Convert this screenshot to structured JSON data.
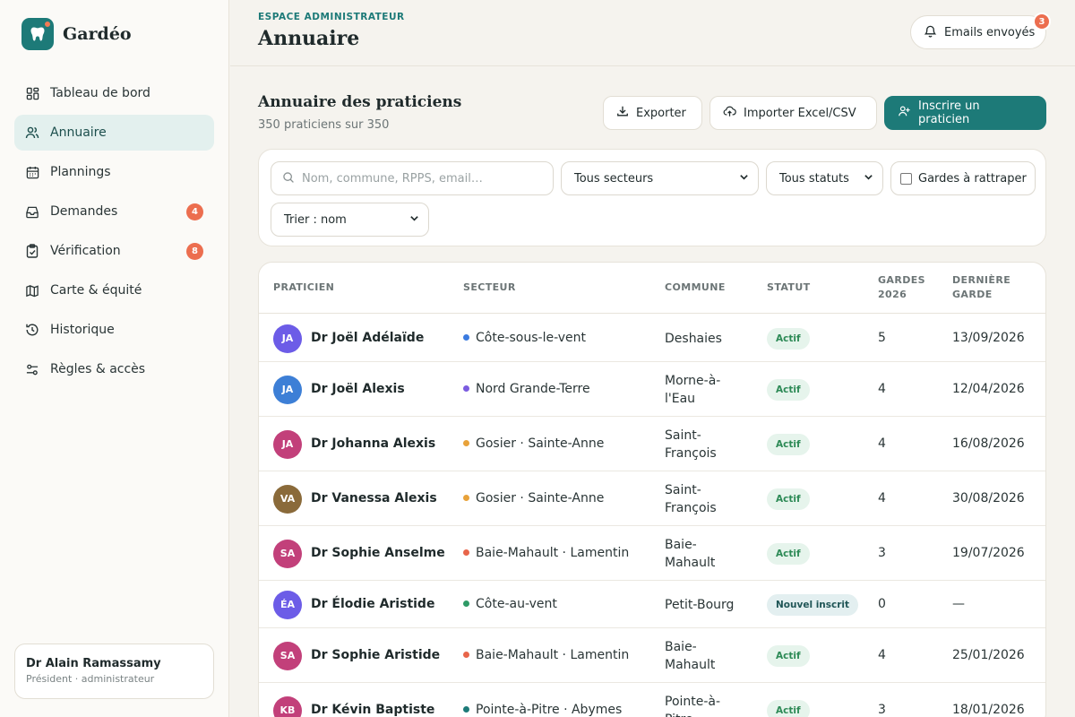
{
  "app": {
    "name": "Gardéo"
  },
  "colors": {
    "accent": "#1d7a78",
    "badge": "#ec6e4f",
    "active_bg": "#e3f0ee"
  },
  "sidebar": {
    "items": [
      {
        "label": "Tableau de bord",
        "icon": "dashboard-icon"
      },
      {
        "label": "Annuaire",
        "icon": "users-icon",
        "active": true
      },
      {
        "label": "Plannings",
        "icon": "calendar-icon"
      },
      {
        "label": "Demandes",
        "icon": "inbox-icon",
        "badge": "4"
      },
      {
        "label": "Vérification",
        "icon": "clipboard-check-icon",
        "badge": "8"
      },
      {
        "label": "Carte & équité",
        "icon": "map-icon"
      },
      {
        "label": "Historique",
        "icon": "history-icon"
      },
      {
        "label": "Règles & accès",
        "icon": "sliders-icon"
      }
    ],
    "user": {
      "name": "Dr Alain Ramassamy",
      "role": "Président · administrateur"
    }
  },
  "header": {
    "eyebrow": "ESPACE ADMINISTRATEUR",
    "title": "Annuaire",
    "emails_label": "Emails envoyés",
    "emails_badge": "3"
  },
  "section": {
    "title": "Annuaire des praticiens",
    "subtitle": "350 praticiens sur 350",
    "export_label": "Exporter",
    "import_label": "Importer Excel/CSV",
    "register_label": "Inscrire un praticien"
  },
  "filters": {
    "search_placeholder": "Nom, commune, RPPS, email…",
    "sector_selected": "Tous secteurs",
    "status_selected": "Tous statuts",
    "checkbox_label": "Gardes à rattraper",
    "sort_selected": "Trier : nom"
  },
  "table": {
    "headers": {
      "praticien": "PRATICIEN",
      "secteur": "SECTEUR",
      "commune": "COMMUNE",
      "statut": "STATUT",
      "gardes_1": "GARDES",
      "gardes_2": "2026",
      "derniere_1": "DERNIÈRE",
      "derniere_2": "GARDE"
    },
    "rows": [
      {
        "initials": "JA",
        "avatar_color": "#6c5ce7",
        "name": "Dr Joël Adélaïde",
        "sector": "Côte-sous-le-vent",
        "sector_color": "#3b7be0",
        "commune_1": "Deshaies",
        "commune_2": "",
        "status": "Actif",
        "gardes": "5",
        "last": "13/09/2026"
      },
      {
        "initials": "JA",
        "avatar_color": "#3d7fd6",
        "name": "Dr Joël Alexis",
        "sector": "Nord Grande-Terre",
        "sector_color": "#7b5ce0",
        "commune_1": "Morne-à-",
        "commune_2": "l'Eau",
        "status": "Actif",
        "gardes": "4",
        "last": "12/04/2026"
      },
      {
        "initials": "JA",
        "avatar_color": "#c2407a",
        "name": "Dr Johanna Alexis",
        "sector": "Gosier · Sainte-Anne",
        "sector_color": "#e8a23a",
        "commune_1": "Saint-",
        "commune_2": "François",
        "status": "Actif",
        "gardes": "4",
        "last": "16/08/2026"
      },
      {
        "initials": "VA",
        "avatar_color": "#8a6a3a",
        "name": "Dr Vanessa Alexis",
        "sector": "Gosier · Sainte-Anne",
        "sector_color": "#e8a23a",
        "commune_1": "Saint-",
        "commune_2": "François",
        "status": "Actif",
        "gardes": "4",
        "last": "30/08/2026"
      },
      {
        "initials": "SA",
        "avatar_color": "#c2407a",
        "name": "Dr Sophie Anselme",
        "sector": "Baie-Mahault · Lamentin",
        "sector_color": "#e8654a",
        "commune_1": "Baie-",
        "commune_2": "Mahault",
        "status": "Actif",
        "gardes": "3",
        "last": "19/07/2026"
      },
      {
        "initials": "ÉA",
        "avatar_color": "#6c5ce7",
        "name": "Dr Élodie Aristide",
        "sector": "Côte-au-vent",
        "sector_color": "#2e9a66",
        "commune_1": "Petit-Bourg",
        "commune_2": "",
        "status": "Nouvel inscrit",
        "gardes": "0",
        "last": "—"
      },
      {
        "initials": "SA",
        "avatar_color": "#c2407a",
        "name": "Dr Sophie Aristide",
        "sector": "Baie-Mahault · Lamentin",
        "sector_color": "#e8654a",
        "commune_1": "Baie-",
        "commune_2": "Mahault",
        "status": "Actif",
        "gardes": "4",
        "last": "25/01/2026"
      },
      {
        "initials": "KB",
        "avatar_color": "#c2407a",
        "name": "Dr Kévin Baptiste",
        "sector": "Pointe-à-Pitre · Abymes",
        "sector_color": "#1d7a78",
        "commune_1": "Pointe-à-",
        "commune_2": "Pitre",
        "status": "Actif",
        "gardes": "3",
        "last": "18/01/2026"
      }
    ]
  }
}
